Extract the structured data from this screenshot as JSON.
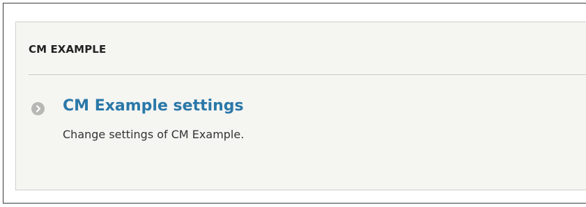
{
  "panel": {
    "title": "CM EXAMPLE",
    "items": [
      {
        "icon": "chevron-right-circle-icon",
        "label": "CM Example settings",
        "description": "Change settings of CM Example."
      }
    ]
  },
  "colors": {
    "link": "#2a78a8",
    "panel_background": "#f5f5f2",
    "icon_background": "#b7b7b3"
  }
}
